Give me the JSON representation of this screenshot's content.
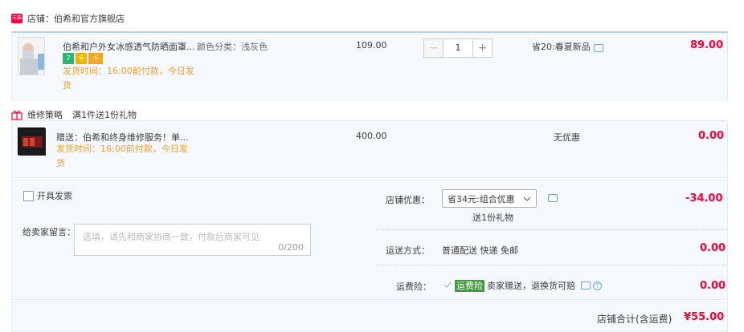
{
  "shop": {
    "badge": "天猫",
    "name": "店铺：伯希和官方旗舰店"
  },
  "item1": {
    "title": "伯希和户外女冰感透气防晒面罩...",
    "spec_label": "颜色分类：浅灰色",
    "ship_text": "发货时间：16:00前付款，今日发货",
    "price": "109.00",
    "quantity": "1",
    "promo": "省20:春夏新品",
    "subtotal": "89.00",
    "badges": [
      "7",
      "卡",
      "卡"
    ]
  },
  "gift_header": {
    "tag": "维修策略",
    "text": "满1件送1份礼物"
  },
  "item2": {
    "title": "赠送：伯希和终身维修服务！单...",
    "ship_text": "发货时间：16:00前付款，今日发货",
    "price": "400.00",
    "promo": "无优惠",
    "subtotal": "0.00"
  },
  "invoice": {
    "label": "开具发票"
  },
  "message": {
    "label": "给卖家留言：",
    "placeholder": "选填，请先和商家协商一致，付款后商家可见",
    "counter": "0/200"
  },
  "shop_discount": {
    "label": "店铺优惠：",
    "value": "省34元:组合优惠",
    "sub": "送1份礼物",
    "amount": "-34.00"
  },
  "shipping": {
    "label": "运送方式：",
    "value": "普通配送 快递 免邮",
    "amount": "0.00"
  },
  "insurance": {
    "label": "运费险：",
    "tag": "运费险",
    "text": "卖家赠送，退换货可赔",
    "amount": "0.00"
  },
  "total": {
    "label": "店铺合计(含运费)",
    "amount": "¥55.00"
  },
  "colors": {
    "accent_red": "#ff0036",
    "orange": "#f2a02b",
    "row_bg": "#f5f8fd"
  }
}
